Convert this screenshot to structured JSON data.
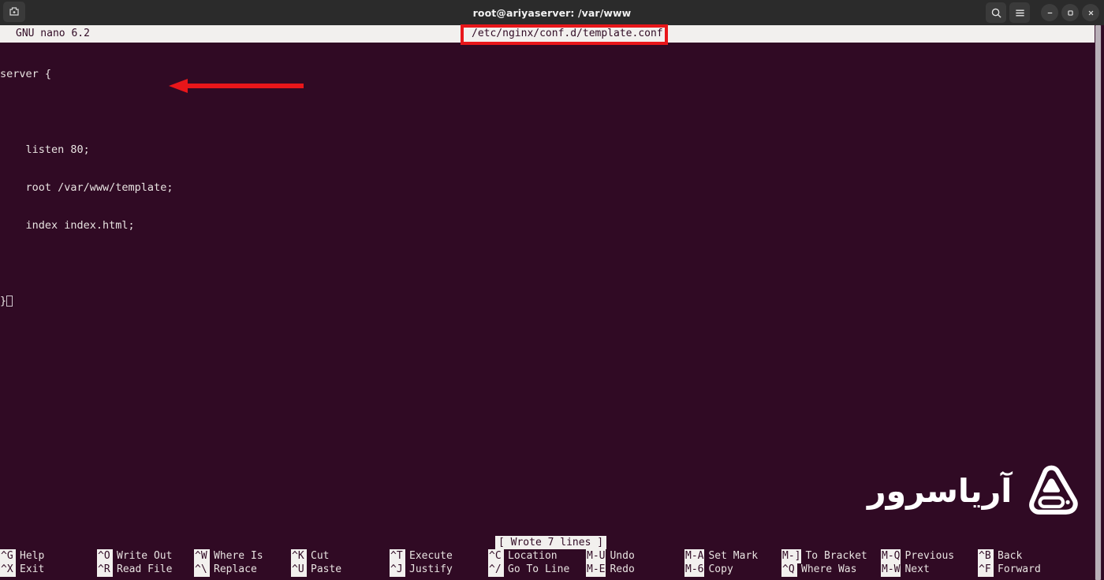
{
  "window": {
    "title": "root@ariyaserver: /var/www",
    "newtab_icon": "new-tab-icon",
    "search_icon": "search-icon",
    "menu_icon": "hamburger-menu-icon",
    "minimize_icon": "minimize-icon",
    "maximize_icon": "maximize-icon",
    "close_icon": "close-icon"
  },
  "nano": {
    "version": "GNU nano 6.2",
    "filename": "/etc/nginx/conf.d/template.conf",
    "modified_flag": ""
  },
  "editor": {
    "lines": [
      "server {",
      "",
      "    listen 80;",
      "    root /var/www/template;",
      "    index index.html;",
      "",
      "}"
    ]
  },
  "status": {
    "message": "[ Wrote 7 lines ]"
  },
  "shortcuts": {
    "row1": [
      {
        "key": "^G",
        "label": "Help"
      },
      {
        "key": "^O",
        "label": "Write Out"
      },
      {
        "key": "^W",
        "label": "Where Is"
      },
      {
        "key": "^K",
        "label": "Cut"
      },
      {
        "key": "^T",
        "label": "Execute"
      },
      {
        "key": "^C",
        "label": "Location"
      },
      {
        "key": "M-U",
        "label": "Undo"
      },
      {
        "key": "M-A",
        "label": "Set Mark"
      },
      {
        "key": "M-]",
        "label": "To Bracket"
      },
      {
        "key": "M-Q",
        "label": "Previous"
      },
      {
        "key": "^B",
        "label": "Back"
      }
    ],
    "row2": [
      {
        "key": "^X",
        "label": "Exit"
      },
      {
        "key": "^R",
        "label": "Read File"
      },
      {
        "key": "^\\",
        "label": "Replace"
      },
      {
        "key": "^U",
        "label": "Paste"
      },
      {
        "key": "^J",
        "label": "Justify"
      },
      {
        "key": "^/",
        "label": "Go To Line"
      },
      {
        "key": "M-E",
        "label": "Redo"
      },
      {
        "key": "M-6",
        "label": "Copy"
      },
      {
        "key": "^Q",
        "label": "Where Was"
      },
      {
        "key": "M-W",
        "label": "Next"
      },
      {
        "key": "^F",
        "label": "Forward"
      }
    ]
  },
  "annotations": {
    "highlight_box_target": "/etc/nginx/conf.d/template.conf",
    "arrow_target": "root /var/www/template;",
    "color": "#e8161a"
  },
  "watermark": {
    "text": "آریاسرور",
    "logo_icon": "ariaserver-logo-icon"
  },
  "colors": {
    "terminal_bg": "#300a24",
    "titlebar_bg": "#2b2b2b",
    "inverted_bg": "#f2f0ee",
    "text": "#e8e3e1",
    "annotation_red": "#e8161a"
  }
}
